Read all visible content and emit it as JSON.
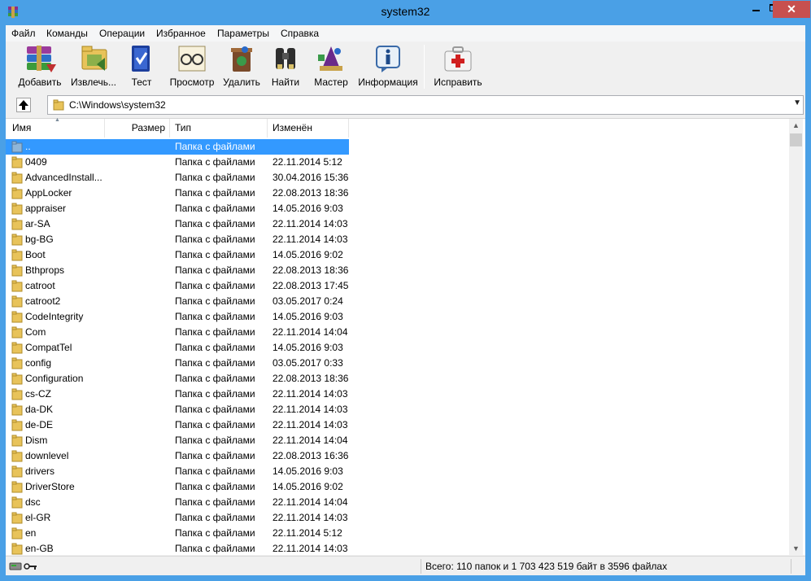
{
  "window": {
    "title": "system32"
  },
  "menu": [
    "Файл",
    "Команды",
    "Операции",
    "Избранное",
    "Параметры",
    "Справка"
  ],
  "toolbar": [
    {
      "label": "Добавить",
      "icon": "books-add-icon"
    },
    {
      "label": "Извлечь...",
      "icon": "folder-extract-icon"
    },
    {
      "label": "Тест",
      "icon": "book-test-icon"
    },
    {
      "label": "Просмотр",
      "icon": "glasses-view-icon"
    },
    {
      "label": "Удалить",
      "icon": "recycle-delete-icon"
    },
    {
      "label": "Найти",
      "icon": "binoculars-find-icon"
    },
    {
      "label": "Мастер",
      "icon": "wizard-icon"
    },
    {
      "label": "Информация",
      "icon": "info-icon"
    },
    {
      "label": "Исправить",
      "icon": "first-aid-repair-icon"
    }
  ],
  "address": {
    "path": "C:\\Windows\\system32"
  },
  "columns": [
    "Имя",
    "Размер",
    "Тип",
    "Изменён"
  ],
  "rows": [
    {
      "name": "..",
      "size": "",
      "type": "Папка с файлами",
      "date": "",
      "selected": true
    },
    {
      "name": "0409",
      "size": "",
      "type": "Папка с файлами",
      "date": "22.11.2014 5:12"
    },
    {
      "name": "AdvancedInstall...",
      "size": "",
      "type": "Папка с файлами",
      "date": "30.04.2016 15:36"
    },
    {
      "name": "AppLocker",
      "size": "",
      "type": "Папка с файлами",
      "date": "22.08.2013 18:36"
    },
    {
      "name": "appraiser",
      "size": "",
      "type": "Папка с файлами",
      "date": "14.05.2016 9:03"
    },
    {
      "name": "ar-SA",
      "size": "",
      "type": "Папка с файлами",
      "date": "22.11.2014 14:03"
    },
    {
      "name": "bg-BG",
      "size": "",
      "type": "Папка с файлами",
      "date": "22.11.2014 14:03"
    },
    {
      "name": "Boot",
      "size": "",
      "type": "Папка с файлами",
      "date": "14.05.2016 9:02"
    },
    {
      "name": "Bthprops",
      "size": "",
      "type": "Папка с файлами",
      "date": "22.08.2013 18:36"
    },
    {
      "name": "catroot",
      "size": "",
      "type": "Папка с файлами",
      "date": "22.08.2013 17:45"
    },
    {
      "name": "catroot2",
      "size": "",
      "type": "Папка с файлами",
      "date": "03.05.2017 0:24"
    },
    {
      "name": "CodeIntegrity",
      "size": "",
      "type": "Папка с файлами",
      "date": "14.05.2016 9:03"
    },
    {
      "name": "Com",
      "size": "",
      "type": "Папка с файлами",
      "date": "22.11.2014 14:04"
    },
    {
      "name": "CompatTel",
      "size": "",
      "type": "Папка с файлами",
      "date": "14.05.2016 9:03"
    },
    {
      "name": "config",
      "size": "",
      "type": "Папка с файлами",
      "date": "03.05.2017 0:33"
    },
    {
      "name": "Configuration",
      "size": "",
      "type": "Папка с файлами",
      "date": "22.08.2013 18:36"
    },
    {
      "name": "cs-CZ",
      "size": "",
      "type": "Папка с файлами",
      "date": "22.11.2014 14:03"
    },
    {
      "name": "da-DK",
      "size": "",
      "type": "Папка с файлами",
      "date": "22.11.2014 14:03"
    },
    {
      "name": "de-DE",
      "size": "",
      "type": "Папка с файлами",
      "date": "22.11.2014 14:03"
    },
    {
      "name": "Dism",
      "size": "",
      "type": "Папка с файлами",
      "date": "22.11.2014 14:04"
    },
    {
      "name": "downlevel",
      "size": "",
      "type": "Папка с файлами",
      "date": "22.08.2013 16:36"
    },
    {
      "name": "drivers",
      "size": "",
      "type": "Папка с файлами",
      "date": "14.05.2016 9:03"
    },
    {
      "name": "DriverStore",
      "size": "",
      "type": "Папка с файлами",
      "date": "14.05.2016 9:02"
    },
    {
      "name": "dsc",
      "size": "",
      "type": "Папка с файлами",
      "date": "22.11.2014 14:04"
    },
    {
      "name": "el-GR",
      "size": "",
      "type": "Папка с файлами",
      "date": "22.11.2014 14:03"
    },
    {
      "name": "en",
      "size": "",
      "type": "Папка с файлами",
      "date": "22.11.2014 5:12"
    },
    {
      "name": "en-GB",
      "size": "",
      "type": "Папка с файлами",
      "date": "22.11.2014 14:03"
    }
  ],
  "status": {
    "text": "Всего: 110 папок и 1 703 423 519 байт в 3596 файлах"
  },
  "colors": {
    "frame": "#4aa0e6",
    "selection": "#3399ff",
    "close": "#c7504f"
  }
}
